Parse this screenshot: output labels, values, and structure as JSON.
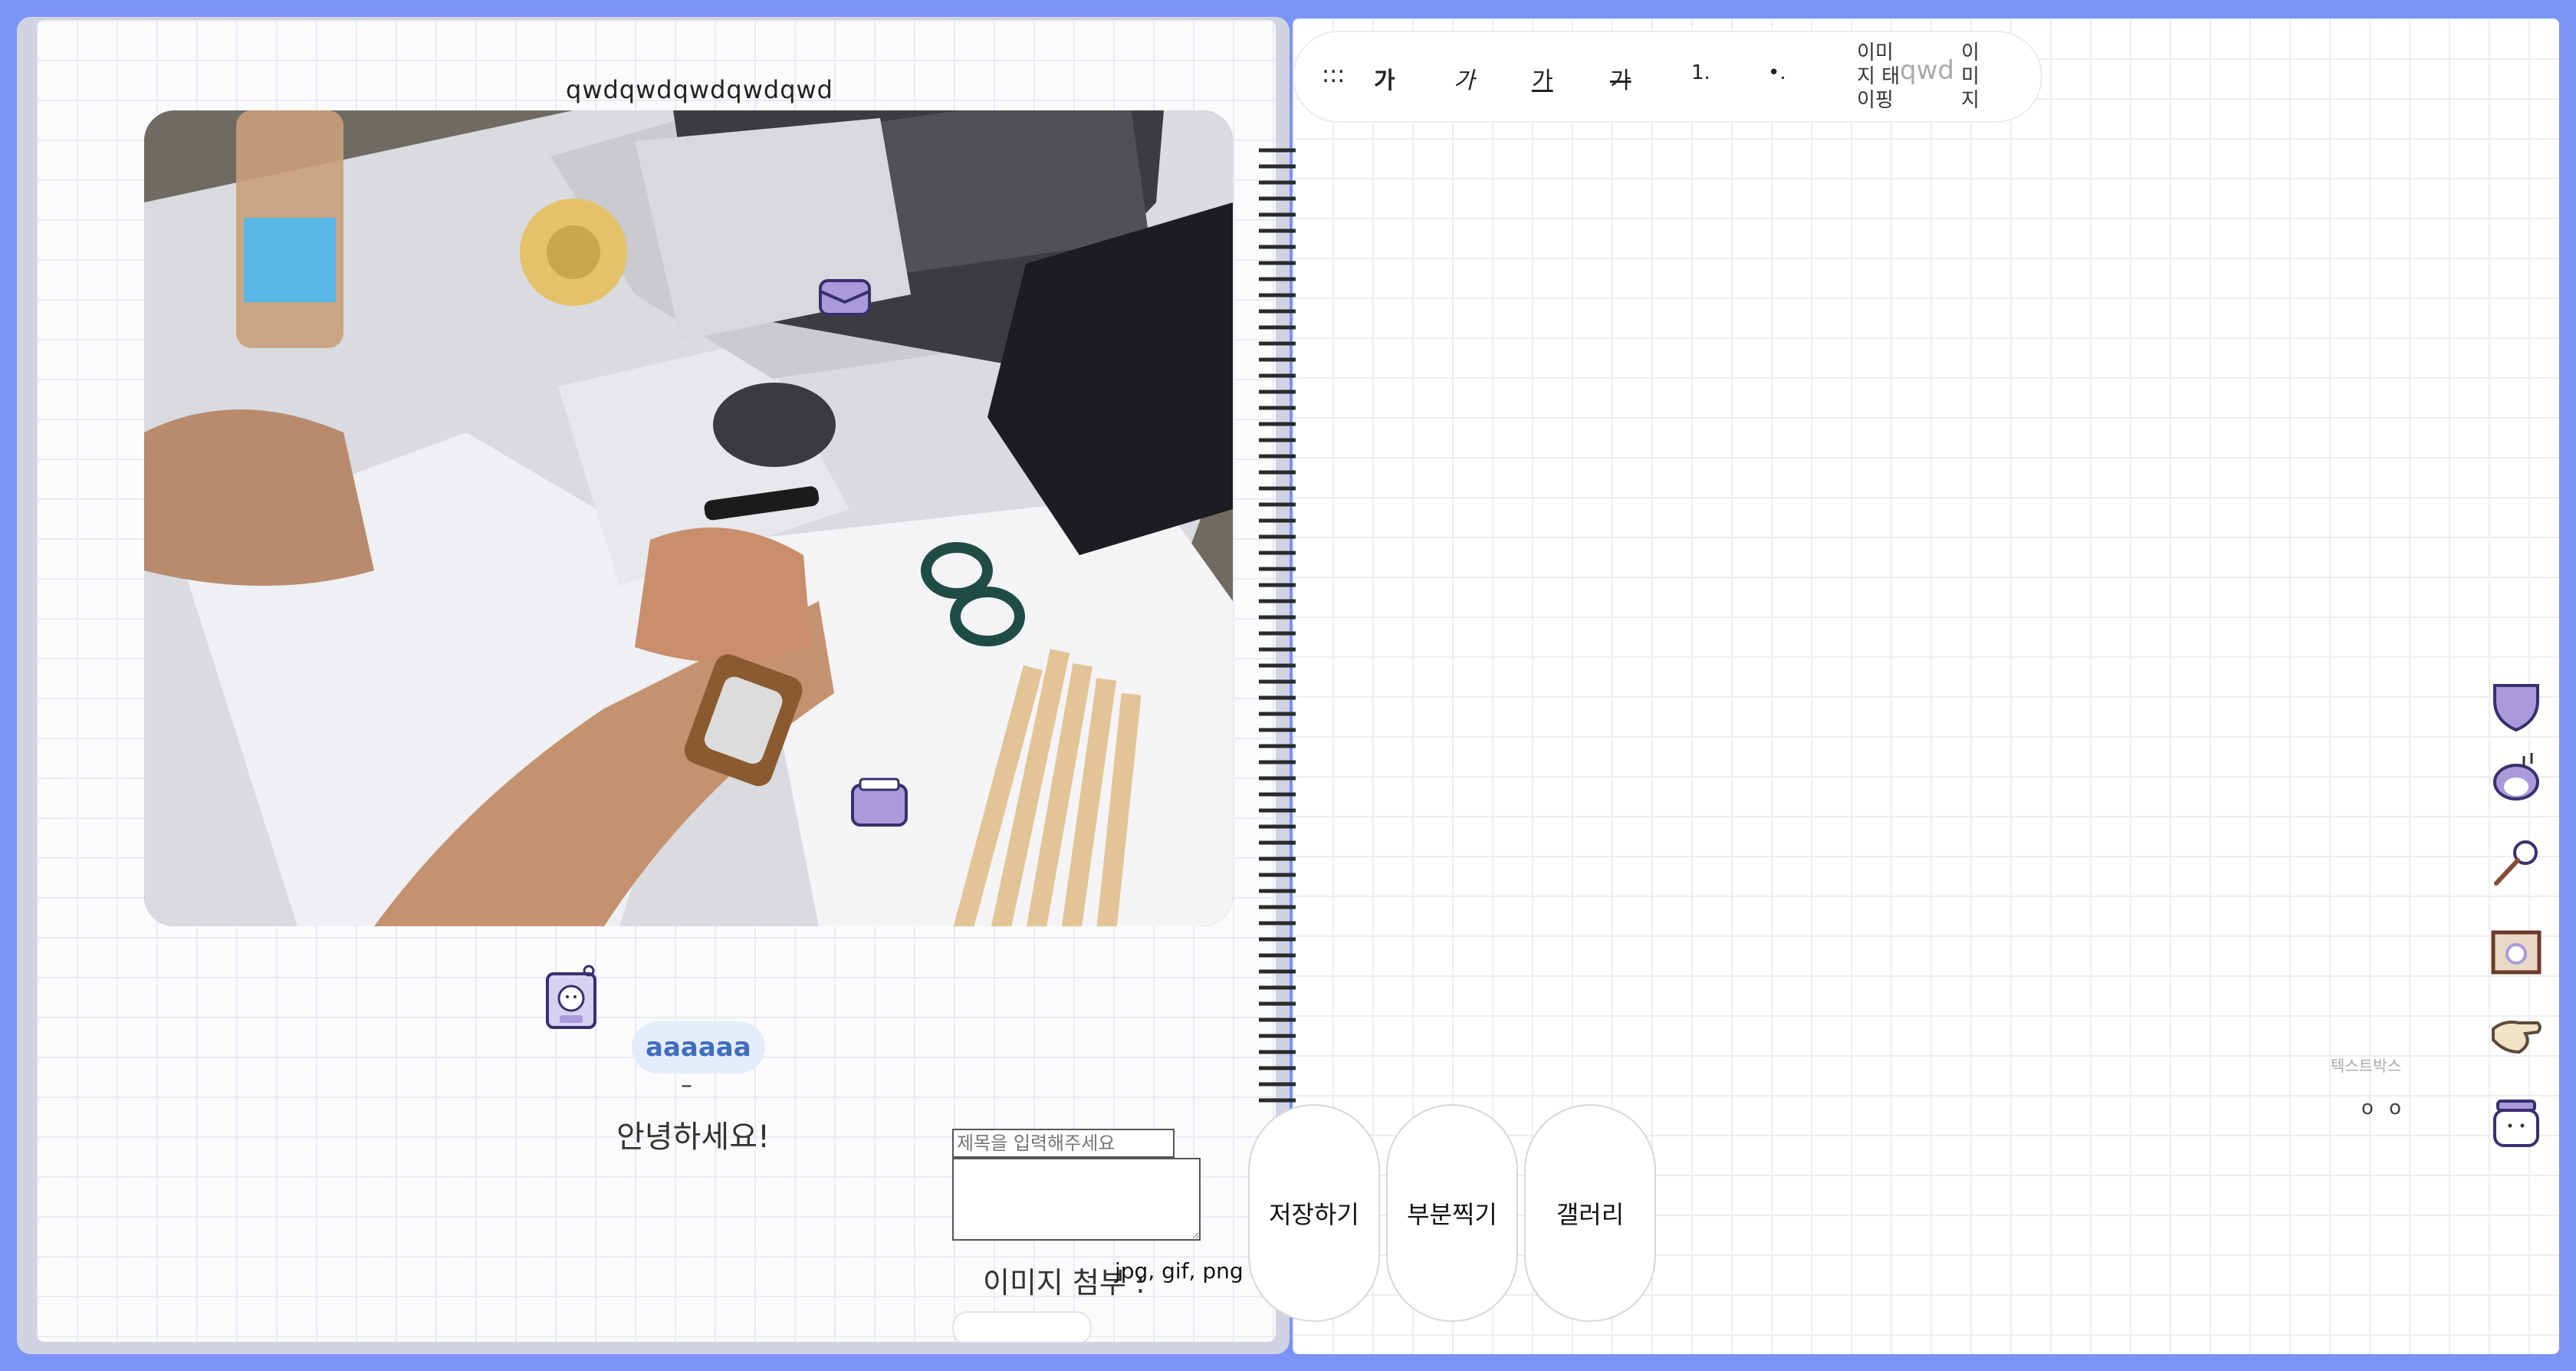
{
  "left_page": {
    "title": "qwdqwdqwdqwdqwd",
    "author": {
      "name": "aaaaaa"
    },
    "dash": "–",
    "greeting": "안녕하세요!",
    "form": {
      "title_placeholder": "제목을 입력해주세요",
      "attach_label": "이미지 첨부 :",
      "attach_note": "jpg, gif, png 파일만"
    }
  },
  "right_page": {
    "toolbar": {
      "drag_handle": ":::",
      "bold": "가",
      "italic": "가",
      "underline": "가",
      "strike": "가",
      "ordered_list": "1.",
      "bullet_list": "•.",
      "image_tagging": "이미지 태이핑",
      "sample_text": "qwd",
      "image": "이미지"
    },
    "buttons": {
      "save": "저장하기",
      "capture": "부분찍기",
      "gallery": "갤러리"
    },
    "textbox": {
      "label": "텍스트박스",
      "dots": "o o"
    },
    "stickers": [
      "shield-sticker",
      "music-cat-sticker",
      "microphone-sticker",
      "framed-picture-sticker",
      "pointing-hand-sticker",
      "jar-sticker"
    ]
  },
  "colors": {
    "frame": "#7b93f5",
    "author_bg": "#e5ecf9",
    "author_text": "#3e6fbf",
    "sticker_purple": "#a99bd9"
  }
}
